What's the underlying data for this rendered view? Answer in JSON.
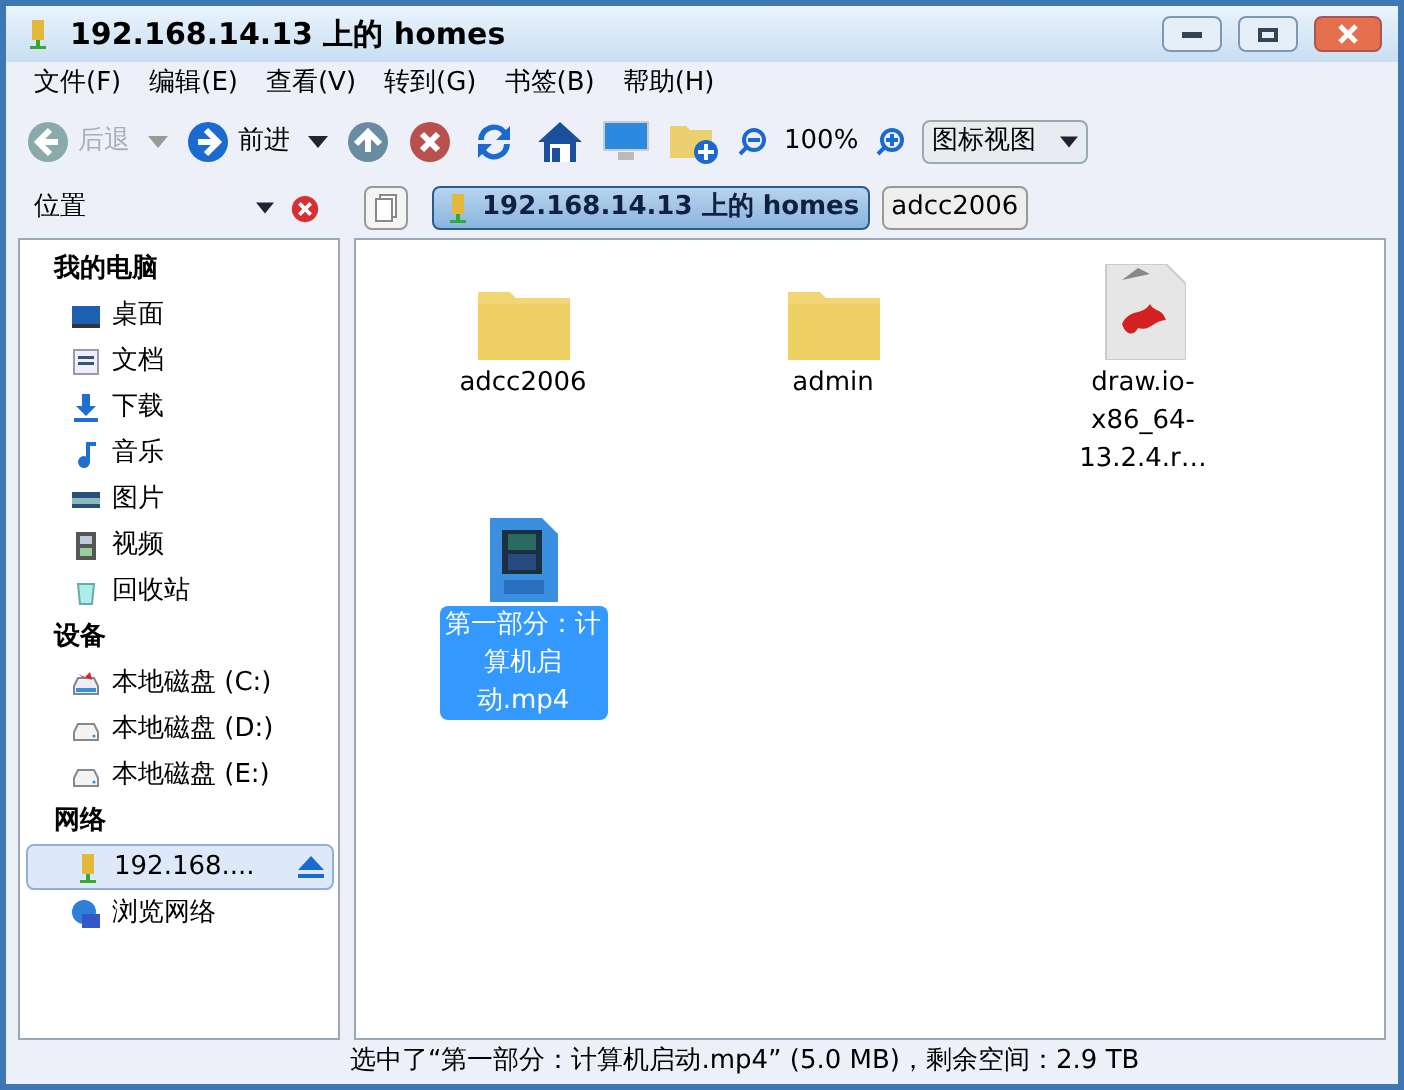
{
  "window": {
    "title": "192.168.14.13 上的 homes"
  },
  "menu": [
    "文件(F)",
    "编辑(E)",
    "查看(V)",
    "转到(G)",
    "书签(B)",
    "帮助(H)"
  ],
  "toolbar": {
    "back": {
      "label": "后退",
      "disabled": true
    },
    "forward": {
      "label": "前进",
      "disabled": false
    },
    "zoom": "100%",
    "view": "图标视图"
  },
  "location": {
    "label": "位置",
    "crumbs": [
      {
        "label": "192.168.14.13 上的 homes",
        "selected": true
      },
      {
        "label": "adcc2006",
        "selected": false
      }
    ]
  },
  "sidebar": [
    {
      "title": "我的电脑",
      "items": [
        {
          "label": "桌面",
          "selected": false
        },
        {
          "label": "文档",
          "selected": false
        },
        {
          "label": "下载",
          "selected": false
        },
        {
          "label": "音乐",
          "selected": false
        },
        {
          "label": "图片",
          "selected": false
        },
        {
          "label": "视频",
          "selected": false
        },
        {
          "label": "回收站",
          "selected": false
        }
      ]
    },
    {
      "title": "设备",
      "items": [
        {
          "label": "本地磁盘 (C:)",
          "selected": false
        },
        {
          "label": "本地磁盘 (D:)",
          "selected": false
        },
        {
          "label": "本地磁盘 (E:)",
          "selected": false
        }
      ]
    },
    {
      "title": "网络",
      "items": [
        {
          "label": "192.168....",
          "selected": true
        },
        {
          "label": "浏览网络",
          "selected": false
        }
      ]
    }
  ],
  "files": [
    {
      "kind": "folder",
      "name": "adcc2006",
      "selected": false
    },
    {
      "kind": "folder",
      "name": "admin",
      "selected": false
    },
    {
      "kind": "package",
      "name": "draw.io-x86_64-13.2.4.r…",
      "selected": false
    },
    {
      "kind": "video",
      "name": "第一部分：计算机启动.mp4",
      "selected": true
    }
  ],
  "status_bar": "选中了“第一部分：计算机启动.mp4” (5.0 MB)，剩余空间：2.9 TB"
}
